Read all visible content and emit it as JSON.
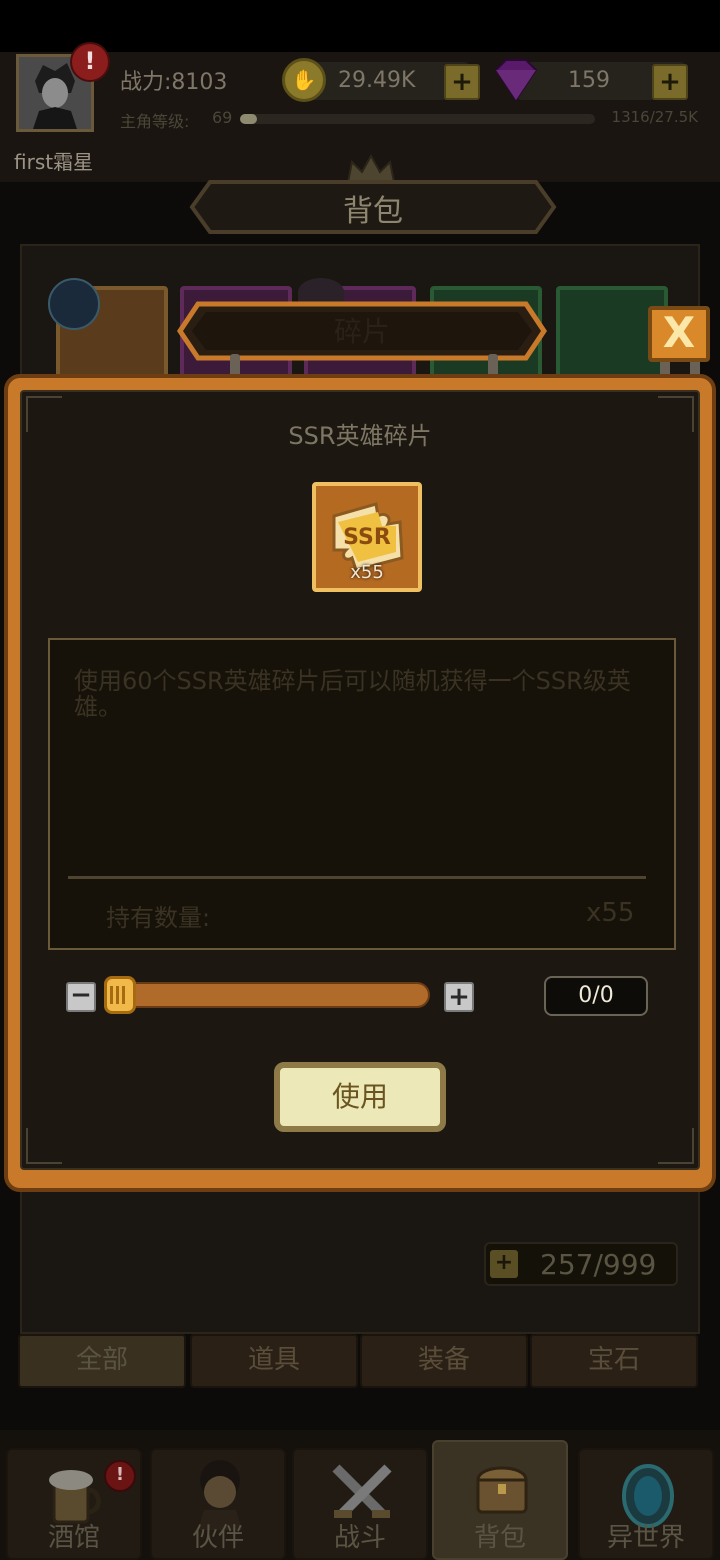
{
  "player": {
    "name": "first霜星",
    "power_label": "战力:8103",
    "level_label": "主角等级:",
    "level_value": "69",
    "xp_text": "1316/27.5K",
    "xp_fraction": 0.048,
    "alert": "!"
  },
  "resources": {
    "gold_value": "29.49K",
    "gem_value": "159",
    "plus": "+"
  },
  "screen": {
    "title": "背包"
  },
  "popup": {
    "header_title": "碎片",
    "close_symbol": "X",
    "item_name": "SSR英雄碎片",
    "item_badge": "SSR",
    "item_count": "x55",
    "description": "使用60个SSR英雄碎片后可以随机获得一个SSR级英雄。",
    "owned_label": "持有数量:",
    "owned_value": "x55",
    "quantity_text": "0/0",
    "slider_fraction": 0,
    "minus": "−",
    "plus": "+",
    "use_label": "使用"
  },
  "inventory": {
    "capacity_text": "257/999",
    "plus": "+",
    "categories": [
      "全部",
      "道具",
      "装备",
      "宝石"
    ]
  },
  "nav": {
    "items": [
      "酒馆",
      "伙伴",
      "战斗",
      "背包",
      "异世界"
    ],
    "alert": "!"
  },
  "colors": {
    "popup_border": "#c87a2a",
    "close_button": "#d9892a",
    "slider_knob": "#f1b84a",
    "use_button": "#ece8b8"
  }
}
